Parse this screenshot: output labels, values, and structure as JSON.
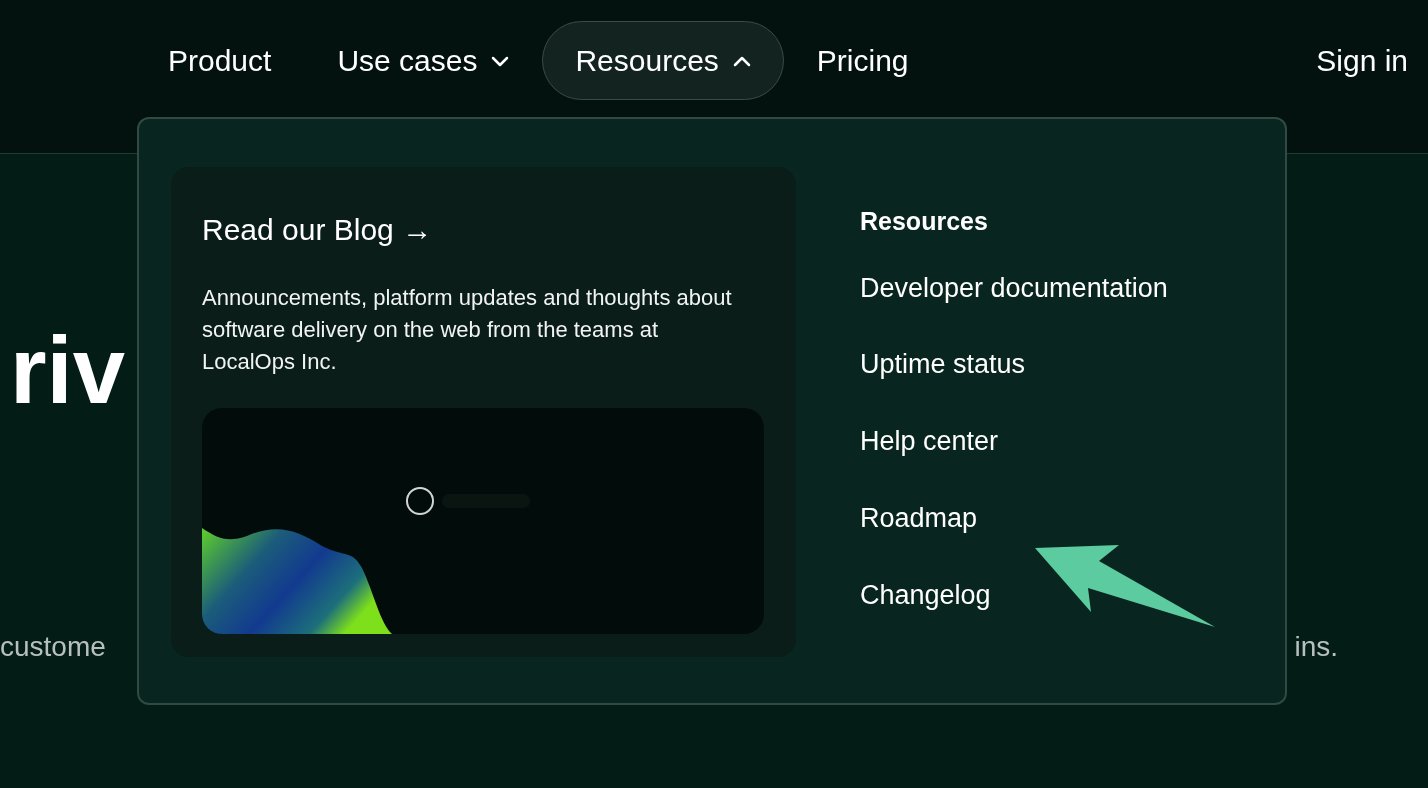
{
  "nav": [
    {
      "label": "Product",
      "kind": "link"
    },
    {
      "label": "Use cases",
      "kind": "menu",
      "expanded": false
    },
    {
      "label": "Resources",
      "kind": "menu",
      "expanded": true
    },
    {
      "label": "Pricing",
      "kind": "link"
    }
  ],
  "sign_in": "Sign in",
  "hero": {
    "heading": "riv",
    "text_left": "custome",
    "text_right": "ins."
  },
  "dropdown": {
    "blog": {
      "title": "Read our Blog →",
      "description": "Announcements, platform updates and thoughts about software delivery on the web from the teams at LocalOps Inc."
    },
    "heading": "Resources",
    "links": [
      "Developer documentation",
      "Uptime status",
      "Help center",
      "Roadmap",
      "Changelog"
    ]
  }
}
